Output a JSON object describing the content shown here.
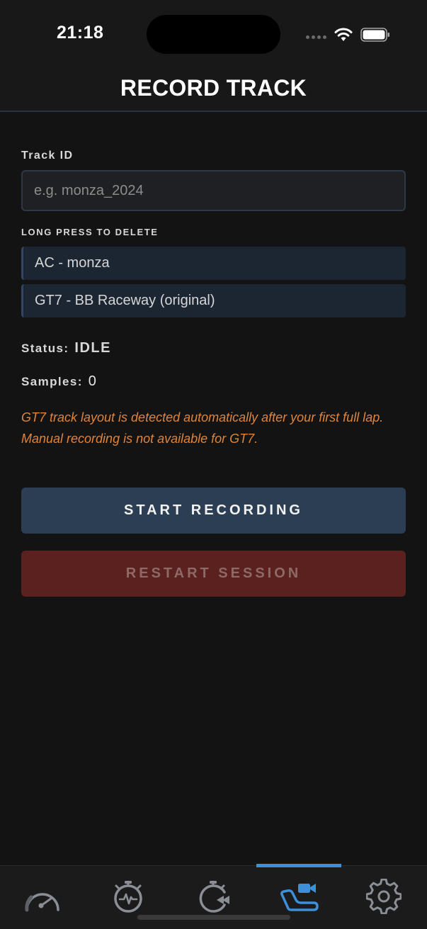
{
  "status_bar": {
    "time": "21:18"
  },
  "header": {
    "title": "RECORD TRACK"
  },
  "form": {
    "track_id_label": "Track ID",
    "track_id_placeholder": "e.g. monza_2024",
    "track_id_value": "",
    "tracks_hint": "LONG PRESS TO DELETE",
    "tracks": [
      {
        "label": "AC - monza"
      },
      {
        "label": "GT7 - BB Raceway (original)"
      }
    ]
  },
  "status": {
    "label": "Status:",
    "value": "IDLE"
  },
  "samples": {
    "label": "Samples:",
    "value": "0"
  },
  "notice": {
    "line1": "GT7 track layout is detected automatically after your first full lap.",
    "line2": "Manual recording is not available for GT7."
  },
  "buttons": {
    "start": "START RECORDING",
    "restart": "RESTART SESSION"
  },
  "tab_bar": {
    "active_index": 3,
    "tabs": [
      {
        "icon": "speedometer-icon"
      },
      {
        "icon": "stopwatch-pulse-icon"
      },
      {
        "icon": "replay-timer-icon"
      },
      {
        "icon": "track-camera-icon"
      },
      {
        "icon": "gear-icon"
      }
    ]
  },
  "colors": {
    "background": "#131313",
    "accent": "#3d8fd9",
    "notice": "#e0843a",
    "start_button": "#2c3e54",
    "restart_button": "#5a211f"
  }
}
